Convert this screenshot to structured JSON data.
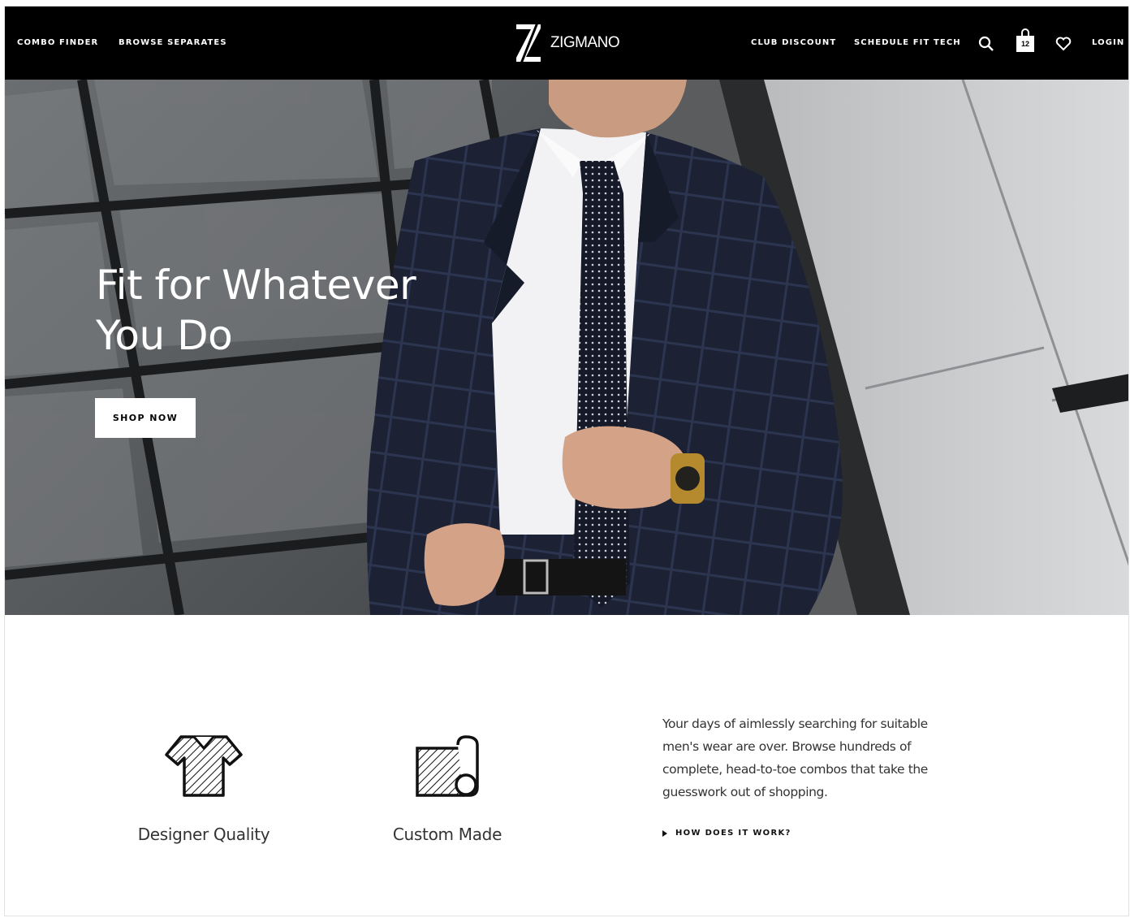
{
  "header": {
    "nav_left": [
      "COMBO FINDER",
      "BROWSE SEPARATES"
    ],
    "brand": "ZIGMANO",
    "nav_right": [
      "CLUB DISCOUNT",
      "SCHEDULE FIT TECH"
    ],
    "bag_count": "12",
    "login": "LOGIN",
    "icons": [
      "search-icon",
      "shopping-bag-icon",
      "heart-icon"
    ]
  },
  "hero": {
    "title_line1": "Fit for Whatever",
    "title_line2": "You Do",
    "cta": "SHOP NOW"
  },
  "features": [
    {
      "label": "Designer Quality",
      "icon": "shirt-icon"
    },
    {
      "label": "Custom Made",
      "icon": "fabric-roll-icon"
    }
  ],
  "intro": {
    "text": "Your days of aimlessly searching for suitable men's wear are over. Browse hundreds of complete, head-to-toe combos that take the guesswork out of shopping.",
    "link": "HOW DOES IT WORK?"
  },
  "colors": {
    "header_bg": "#000000",
    "page_bg": "#ffffff",
    "text": "#333333"
  }
}
